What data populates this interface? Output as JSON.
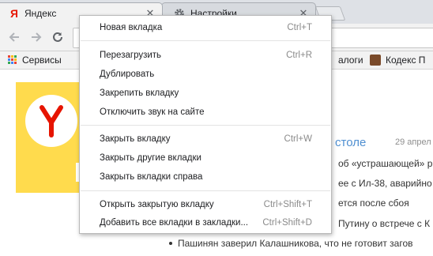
{
  "tabs": [
    {
      "title": "Яндекс",
      "favicon": "yandex-logo-icon",
      "active": true
    },
    {
      "title": "Настройки",
      "favicon": "gear-icon",
      "active": false
    }
  ],
  "toolbar": {
    "back": "back-arrow-icon",
    "forward": "forward-arrow-icon",
    "reload": "reload-icon"
  },
  "bookmarks": {
    "apps_label": "Сервисы",
    "catalogs_label": "алоги",
    "codes_label": "Кодекс П"
  },
  "page": {
    "news_title": "столе",
    "news_date": "29 апрел",
    "news": [
      "об «устрашающей» р",
      "ее с Ил-38, аварийно",
      "ется после сбоя",
      "Путину о встрече с К"
    ],
    "news_last": "Пашинян заверил Калашникова, что не готовит загов"
  },
  "context_menu": {
    "groups": [
      [
        {
          "label": "Новая вкладка",
          "shortcut": "Ctrl+T"
        }
      ],
      [
        {
          "label": "Перезагрузить",
          "shortcut": "Ctrl+R"
        },
        {
          "label": "Дублировать",
          "shortcut": ""
        },
        {
          "label": "Закрепить вкладку",
          "shortcut": ""
        },
        {
          "label": "Отключить звук на сайте",
          "shortcut": ""
        }
      ],
      [
        {
          "label": "Закрыть вкладку",
          "shortcut": "Ctrl+W"
        },
        {
          "label": "Закрыть другие вкладки",
          "shortcut": ""
        },
        {
          "label": "Закрыть вкладки справа",
          "shortcut": ""
        }
      ],
      [
        {
          "label": "Открыть закрытую вкладку",
          "shortcut": "Ctrl+Shift+T"
        },
        {
          "label": "Добавить все вкладки в закладки...",
          "shortcut": "Ctrl+Shift+D"
        }
      ]
    ]
  },
  "colors": {
    "yandex_red": "#e61400",
    "yandex_yellow": "#ffdb4d",
    "link_blue": "#4f8fd1"
  }
}
